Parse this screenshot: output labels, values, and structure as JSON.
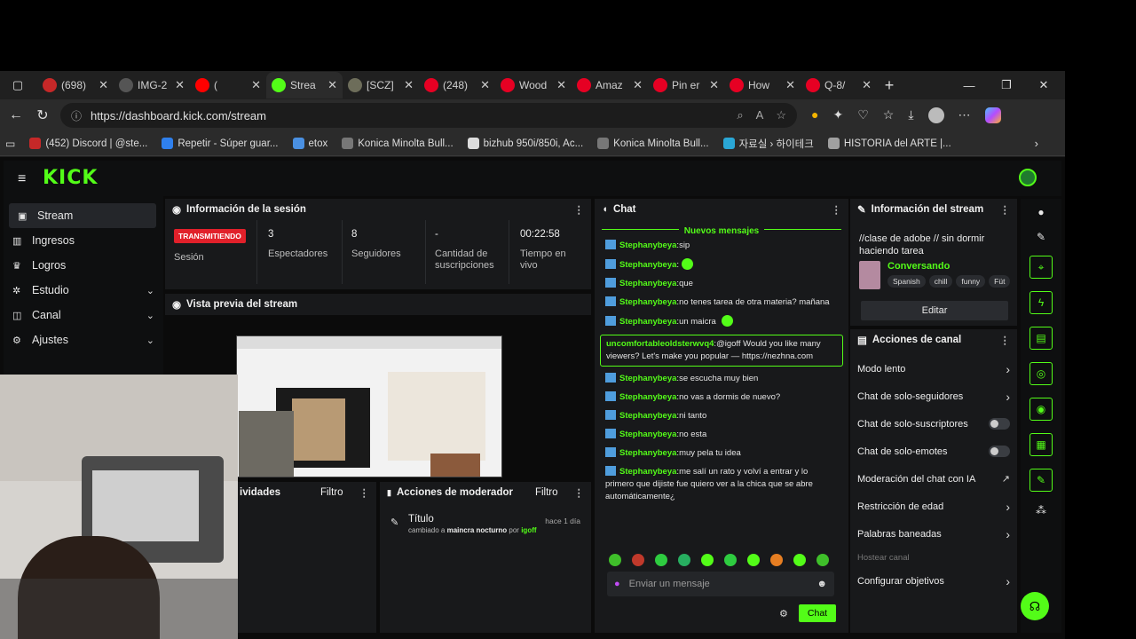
{
  "browser": {
    "tabs": [
      {
        "title": "(698)",
        "icon": "mail-icon",
        "color": "#c62828"
      },
      {
        "title": "IMG-2",
        "icon": "globe-icon",
        "color": "#555555"
      },
      {
        "title": "(",
        "icon": "youtube-icon",
        "color": "#ff0000"
      },
      {
        "title": "Strea",
        "icon": "kick-icon",
        "color": "#53fc18"
      },
      {
        "title": "[SCZ]",
        "icon": "circle-icon",
        "color": "#6d6d5a"
      },
      {
        "title": "(248)",
        "icon": "pinterest-icon",
        "color": "#e60023"
      },
      {
        "title": "Wood",
        "icon": "pinterest-icon",
        "color": "#e60023"
      },
      {
        "title": "Amaz",
        "icon": "pinterest-icon",
        "color": "#e60023"
      },
      {
        "title": "Pin er",
        "icon": "pinterest-icon",
        "color": "#e60023"
      },
      {
        "title": "How",
        "icon": "pinterest-icon",
        "color": "#e60023"
      },
      {
        "title": "Q-8/",
        "icon": "pinterest-icon",
        "color": "#e60023"
      }
    ],
    "url": "https://dashboard.kick.com/stream",
    "bookmarks": [
      {
        "label": "(452) Discord | @ste...",
        "color": "#c62828"
      },
      {
        "label": "Repetir - Súper guar...",
        "color": "#2f80ed"
      },
      {
        "label": "etox",
        "color": "#4a90e2"
      },
      {
        "label": "Konica Minolta Bull...",
        "color": "#777777"
      },
      {
        "label": "bizhub 950i/850i, Ac...",
        "color": "#dddddd"
      },
      {
        "label": "Konica Minolta Bull...",
        "color": "#777777"
      },
      {
        "label": "자료실 › 하이테크",
        "color": "#2aa7d6"
      },
      {
        "label": "HISTORIA del ARTE |...",
        "color": "#a0a0a0"
      }
    ]
  },
  "kick": {
    "logo": "KICK",
    "sidebar": [
      {
        "label": "Stream",
        "icon": "video-icon",
        "chevron": false,
        "active": true
      },
      {
        "label": "Ingresos",
        "icon": "money-icon",
        "chevron": false,
        "active": false
      },
      {
        "label": "Logros",
        "icon": "trophy-icon",
        "chevron": false,
        "active": false
      },
      {
        "label": "Estudio",
        "icon": "studio-icon",
        "chevron": true,
        "active": false
      },
      {
        "label": "Canal",
        "icon": "channel-icon",
        "chevron": true,
        "active": false
      },
      {
        "label": "Ajustes",
        "icon": "gear-icon",
        "chevron": true,
        "active": false
      }
    ],
    "session": {
      "title": "Información de la sesión",
      "status_badge": "TRANSMITIENDO",
      "status_label": "Sesión",
      "stats": [
        {
          "value": "3",
          "label": "Espectadores"
        },
        {
          "value": "8",
          "label": "Seguidores"
        },
        {
          "value": "-",
          "label": "Cantidad de suscripciones"
        },
        {
          "value": "00:22:58",
          "label": "Tiempo en vivo"
        }
      ]
    },
    "preview": {
      "title": "Vista previa del stream"
    },
    "activity": {
      "title": "ividades",
      "filter": "Filtro"
    },
    "mod_actions": {
      "title": "Acciones de moderador",
      "filter": "Filtro",
      "item": {
        "title": "Título",
        "time": "hace 1 día",
        "pre": "cambiado a",
        "value": "maincra nocturno",
        "by": "por",
        "user": "igoff"
      }
    },
    "chat": {
      "title": "Chat",
      "new_messages": "Nuevos mensajes",
      "messages": [
        {
          "user": "Stephanybeya",
          "text": "sip"
        },
        {
          "user": "Stephanybeya",
          "text": ""
        },
        {
          "user": "Stephanybeya",
          "text": "que"
        },
        {
          "user": "Stephanybeya",
          "text": "no tenes tarea de otra materia? mañana"
        },
        {
          "user": "Stephanybeya",
          "text": "un maicra"
        },
        {
          "user": "uncomfortableoldsterwvq4",
          "text": "@igoff Would you like many viewers? Let's make you popular — https://nezhna.com",
          "highlight": true
        },
        {
          "user": "Stephanybeya",
          "text": "se escucha muy bien"
        },
        {
          "user": "Stephanybeya",
          "text": "no vas a dormis de nuevo?"
        },
        {
          "user": "Stephanybeya",
          "text": "ni tanto"
        },
        {
          "user": "Stephanybeya",
          "text": "no esta"
        },
        {
          "user": "Stephanybeya",
          "text": "muy pela tu idea"
        },
        {
          "user": "Stephanybeya",
          "text": "me salí un rato y volví a entrar y lo primero que dijiste fue quiero ver a la chica que se abre automáticamente¿"
        }
      ],
      "placeholder": "Enviar un mensaje",
      "send_label": "Chat"
    },
    "stream_info": {
      "title": "Información del stream",
      "stream_title": "//clase de adobe // sin dormir haciendo tarea",
      "category": "Conversando",
      "tags": [
        "Spanish",
        "chill",
        "funny",
        "Füt"
      ],
      "edit_label": "Editar"
    },
    "channel_actions": {
      "title": "Acciones de canal",
      "items": [
        {
          "label": "Modo lento",
          "control": "chevron"
        },
        {
          "label": "Chat de solo-seguidores",
          "control": "chevron"
        },
        {
          "label": "Chat de solo-suscriptores",
          "control": "toggle"
        },
        {
          "label": "Chat de solo-emotes",
          "control": "toggle"
        },
        {
          "label": "Moderación del chat con IA",
          "control": "external"
        },
        {
          "label": "Restricción de edad",
          "control": "chevron"
        },
        {
          "label": "Palabras baneadas",
          "control": "chevron"
        },
        {
          "label": "Hostear canal",
          "control": "none",
          "disabled": true
        },
        {
          "label": "Configurar objetivos",
          "control": "chevron"
        }
      ]
    },
    "accent": "#53fc18"
  }
}
